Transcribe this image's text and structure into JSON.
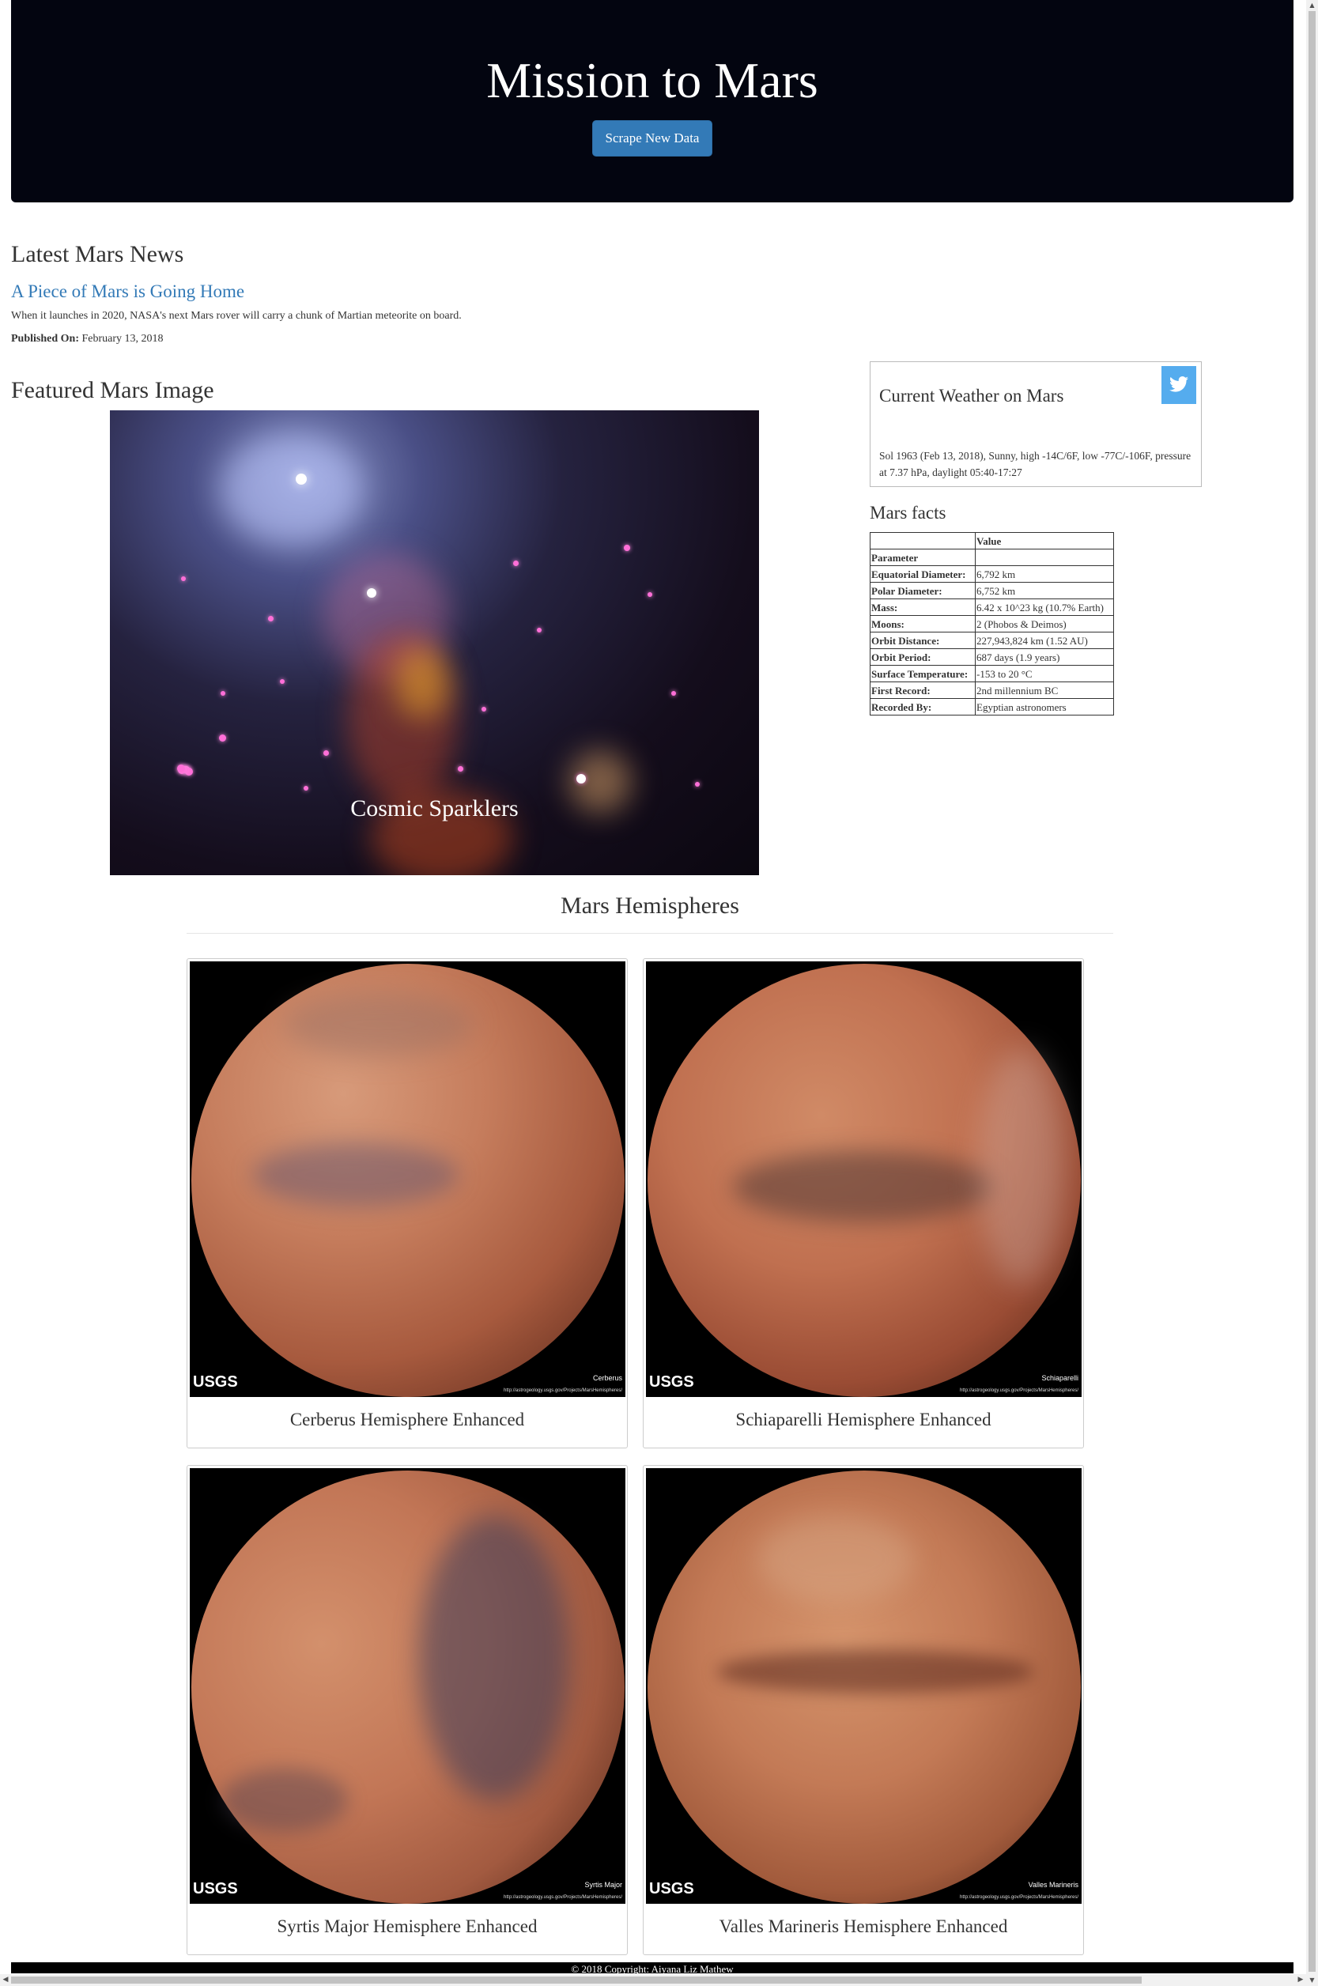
{
  "header": {
    "title": "Mission to Mars",
    "scrape_button": "Scrape New Data"
  },
  "news": {
    "heading": "Latest Mars News",
    "title": "A Piece of Mars is Going Home",
    "paragraph": "When it launches in 2020, NASA's next Mars rover will carry a chunk of Martian meteorite on board.",
    "published_label": "Published On:",
    "published_date": "February 13, 2018"
  },
  "featured": {
    "heading": "Featured Mars Image",
    "caption": "Cosmic Sparklers"
  },
  "weather": {
    "heading": "Current Weather on Mars",
    "icon": "twitter-icon",
    "text": "Sol 1963 (Feb 13, 2018), Sunny, high -14C/6F, low -77C/-106F, pressure at 7.37 hPa, daylight 05:40-17:27"
  },
  "facts": {
    "heading": "Mars facts",
    "header_value": "Value",
    "index_label": "Parameter",
    "rows": [
      {
        "k": "Equatorial Diameter:",
        "v": "6,792 km"
      },
      {
        "k": "Polar Diameter:",
        "v": "6,752 km"
      },
      {
        "k": "Mass:",
        "v": "6.42 x 10^23 kg (10.7% Earth)"
      },
      {
        "k": "Moons:",
        "v": "2 (Phobos & Deimos)"
      },
      {
        "k": "Orbit Distance:",
        "v": "227,943,824 km (1.52 AU)"
      },
      {
        "k": "Orbit Period:",
        "v": "687 days (1.9 years)"
      },
      {
        "k": "Surface Temperature:",
        "v": "-153 to 20 °C"
      },
      {
        "k": "First Record:",
        "v": "2nd millennium BC"
      },
      {
        "k": "Recorded By:",
        "v": "Egyptian astronomers"
      }
    ]
  },
  "hemispheres": {
    "heading": "Mars Hemispheres",
    "logo_text": "USGS",
    "url_text": "http://astrogeology.usgs.gov/Projects/MarsHemispheres/",
    "items": [
      {
        "title": "Cerberus Hemisphere Enhanced",
        "label": "Cerberus"
      },
      {
        "title": "Schiaparelli Hemisphere Enhanced",
        "label": "Schiaparelli"
      },
      {
        "title": "Syrtis Major Hemisphere Enhanced",
        "label": "Syrtis Major"
      },
      {
        "title": "Valles Marineris Hemisphere Enhanced",
        "label": "Valles Marineris"
      }
    ]
  },
  "footer": {
    "text": "© 2018 Copyright: Aiyana Liz Mathew"
  },
  "colors": {
    "jumbotron": "#030510",
    "accent": "#337ab7",
    "twitter": "#55acee"
  }
}
